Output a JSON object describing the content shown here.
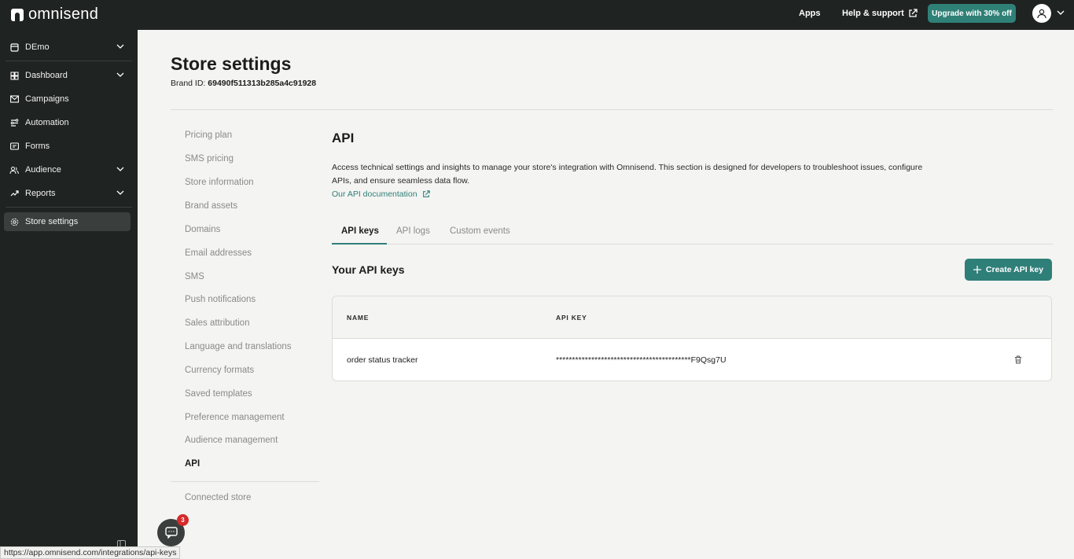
{
  "topbar": {
    "logo_text": "omnisend",
    "apps_label": "Apps",
    "help_label": "Help & support",
    "upgrade_label": "Upgrade with 30% off"
  },
  "sidebar": {
    "store_label": "DEmo",
    "items": [
      {
        "label": "Dashboard",
        "icon": "dashboard-icon",
        "has_chevron": true
      },
      {
        "label": "Campaigns",
        "icon": "mail-icon",
        "has_chevron": false
      },
      {
        "label": "Automation",
        "icon": "automation-icon",
        "has_chevron": false
      },
      {
        "label": "Forms",
        "icon": "forms-icon",
        "has_chevron": false
      },
      {
        "label": "Audience",
        "icon": "audience-icon",
        "has_chevron": true
      },
      {
        "label": "Reports",
        "icon": "reports-icon",
        "has_chevron": true
      }
    ],
    "settings_label": "Store settings"
  },
  "page": {
    "title": "Store settings",
    "brand_id_label": "Brand ID:",
    "brand_id_value": "69490f511313b285a4c91928"
  },
  "settings_nav": {
    "items": [
      "Pricing plan",
      "SMS pricing",
      "Store information",
      "Brand assets",
      "Domains",
      "Email addresses",
      "SMS",
      "Push notifications",
      "Sales attribution",
      "Language and translations",
      "Currency formats",
      "Saved templates",
      "Preference management",
      "Audience management",
      "API"
    ],
    "active": "API",
    "connected_store": "Connected store"
  },
  "api": {
    "title": "API",
    "description": "Access technical settings and insights to manage your store's integration with Omnisend. This section is designed for developers to troubleshoot issues, configure APIs, and ensure seamless data flow.",
    "doc_link": "Our API documentation",
    "tabs": [
      "API keys",
      "API logs",
      "Custom events"
    ],
    "active_tab": "API keys",
    "keys_heading": "Your API keys",
    "create_button": "Create API key",
    "table": {
      "headers": [
        "NAME",
        "API KEY"
      ],
      "rows": [
        {
          "name": "order status tracker",
          "key": "******************************************F9Qsg7U"
        }
      ]
    }
  },
  "status_url": "https://app.omnisend.com/integrations/api-keys",
  "chat": {
    "badge_count": "3"
  },
  "colors": {
    "accent": "#2f7f79",
    "sidebar_bg": "#1f2322",
    "page_bg": "#f4f4f2",
    "badge": "#d62a2a"
  }
}
